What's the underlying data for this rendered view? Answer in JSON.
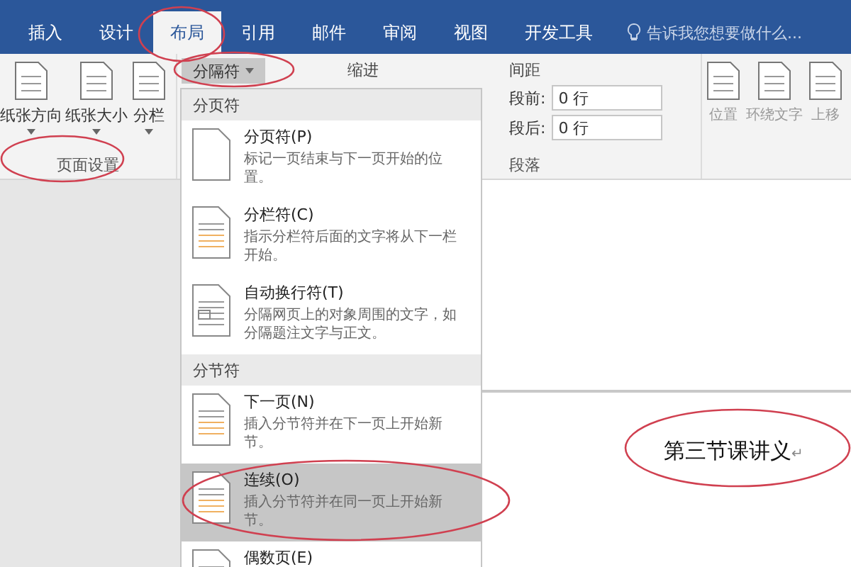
{
  "tabs": [
    {
      "label": "插入",
      "selected": false
    },
    {
      "label": "设计",
      "selected": false
    },
    {
      "label": "布局",
      "selected": true
    },
    {
      "label": "引用",
      "selected": false
    },
    {
      "label": "邮件",
      "selected": false
    },
    {
      "label": "审阅",
      "selected": false
    },
    {
      "label": "视图",
      "selected": false
    },
    {
      "label": "开发工具",
      "selected": false
    }
  ],
  "search": {
    "placeholder": "告诉我您想要做什么..."
  },
  "page_setup": {
    "buttons": [
      "纸张方向",
      "纸张大小",
      "分栏"
    ],
    "label": "页面设置"
  },
  "breaks_button": "分隔符",
  "paragraph": {
    "indent_label": "缩进",
    "spacing_label": "间距",
    "before_label": "段前:",
    "before_value": "0 行",
    "after_label": "段后:",
    "after_value": "0 行",
    "label": "段落"
  },
  "arrange": [
    "位置",
    "环绕文字",
    "上移"
  ],
  "breaks_menu": [
    {
      "title": "分页符",
      "items": [
        {
          "name": "分页符(P)",
          "description": "标记一页结束与下一页开始的位置。",
          "selected": false,
          "kind": "page"
        },
        {
          "name": "分栏符(C)",
          "description": "指示分栏符后面的文字将从下一栏开始。",
          "selected": false,
          "kind": "column"
        },
        {
          "name": "自动换行符(T)",
          "description": "分隔网页上的对象周围的文字，如分隔题注文字与正文。",
          "selected": false,
          "kind": "wrap"
        }
      ]
    },
    {
      "title": "分节符",
      "items": [
        {
          "name": "下一页(N)",
          "description": "插入分节符并在下一页上开始新节。",
          "selected": false,
          "kind": "next"
        },
        {
          "name": "连续(O)",
          "description": "插入分节符并在同一页上开始新节。",
          "selected": true,
          "kind": "continuous"
        },
        {
          "name": "偶数页(E)",
          "selected": false,
          "kind": "even"
        }
      ]
    }
  ],
  "document": {
    "text": "第三节课讲义",
    "mark": "↵"
  }
}
